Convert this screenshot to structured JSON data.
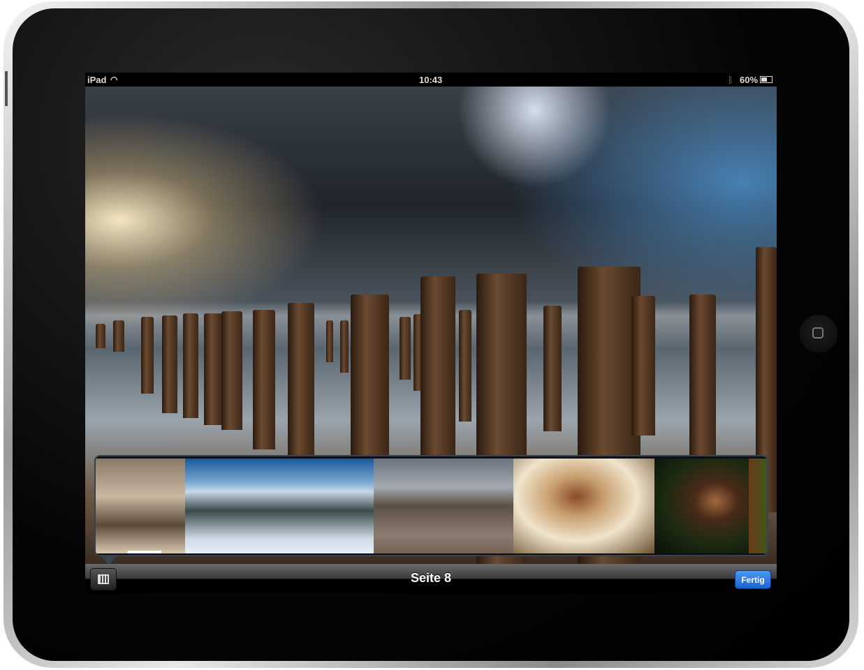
{
  "status_bar": {
    "device": "iPad",
    "time": "10:43",
    "battery": "60%",
    "battery_level": 0.6
  },
  "toolbar": {
    "title": "Seite 8",
    "done_label": "Fertig"
  },
  "thumbnails": [
    {
      "name": "castle-fog",
      "selected": true
    },
    {
      "name": "snowy-mountains",
      "selected": false
    },
    {
      "name": "beach-posts",
      "selected": false
    },
    {
      "name": "portrait-woman",
      "selected": false
    },
    {
      "name": "frog",
      "selected": false
    },
    {
      "name": "partial",
      "selected": false
    }
  ],
  "colors": {
    "accent": "#1a62d6"
  }
}
